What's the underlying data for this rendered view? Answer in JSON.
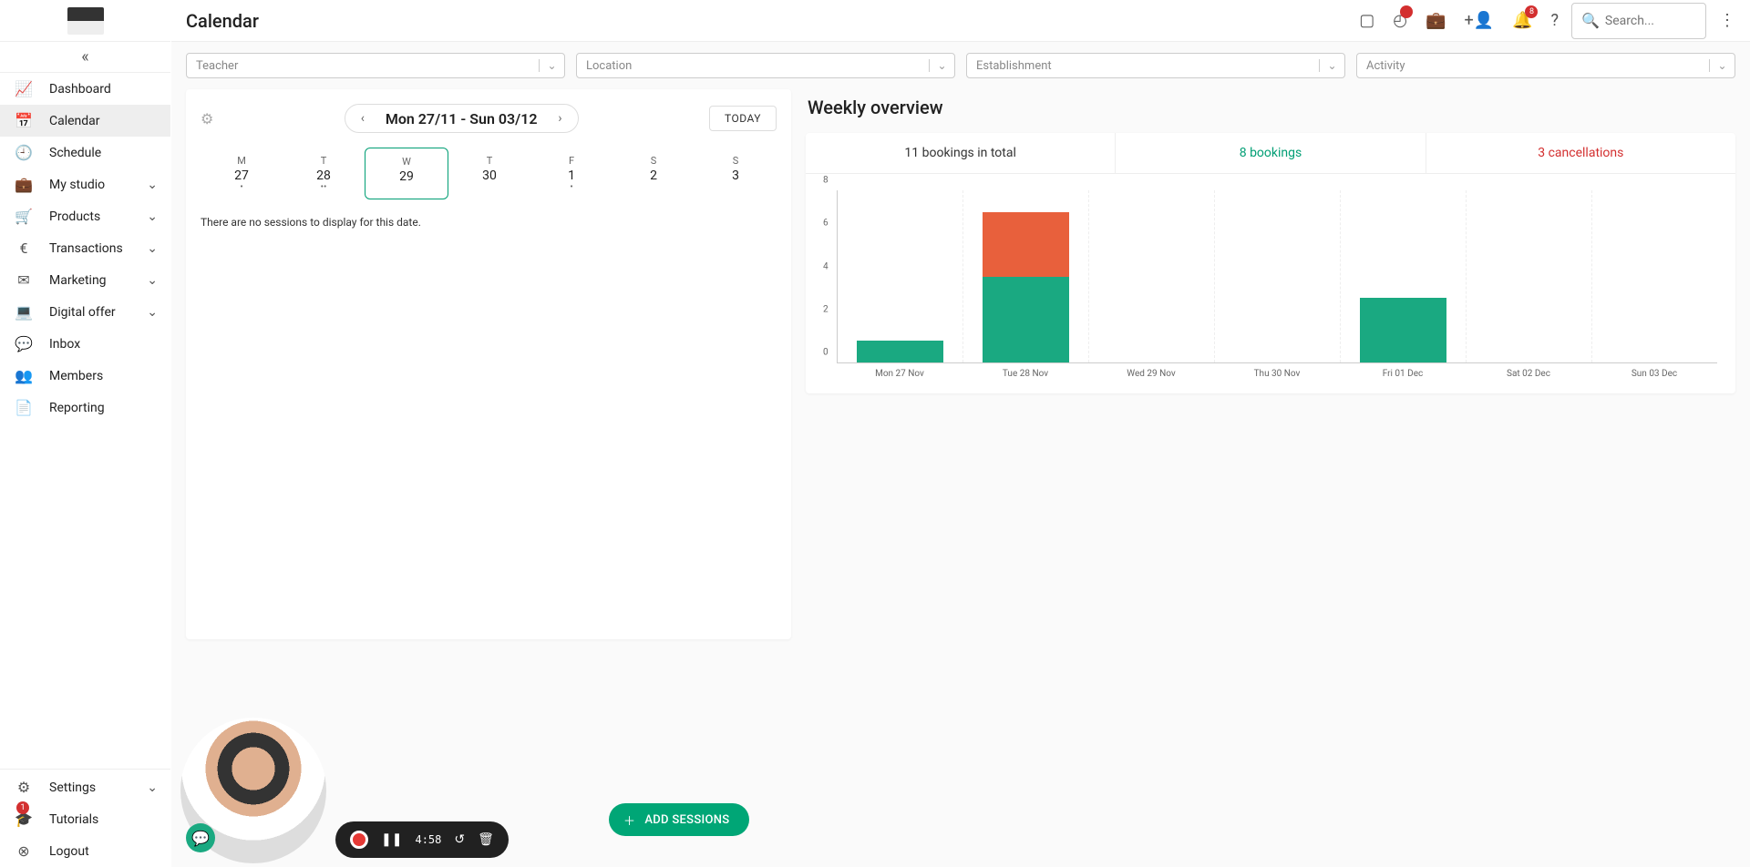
{
  "header": {
    "title": "Calendar",
    "search_placeholder": "Search...",
    "badges": {
      "alert": "",
      "bell": "8"
    }
  },
  "sidebar": {
    "items": [
      {
        "label": "Dashboard",
        "icon": "📈",
        "expandable": false
      },
      {
        "label": "Calendar",
        "icon": "📅",
        "expandable": false,
        "active": true
      },
      {
        "label": "Schedule",
        "icon": "🕘",
        "expandable": false
      },
      {
        "label": "My studio",
        "icon": "💼",
        "expandable": true
      },
      {
        "label": "Products",
        "icon": "🛒",
        "expandable": true
      },
      {
        "label": "Transactions",
        "icon": "€",
        "expandable": true
      },
      {
        "label": "Marketing",
        "icon": "✉",
        "expandable": true
      },
      {
        "label": "Digital offer",
        "icon": "💻",
        "expandable": true
      },
      {
        "label": "Inbox",
        "icon": "💬",
        "expandable": false
      },
      {
        "label": "Members",
        "icon": "👥",
        "expandable": false
      },
      {
        "label": "Reporting",
        "icon": "📄",
        "expandable": false
      }
    ],
    "settings_label": "Settings",
    "tutorials_label": "Tutorials",
    "tutorials_badge": "1",
    "logout_label": "Logout"
  },
  "filters": {
    "teacher": "Teacher",
    "location": "Location",
    "establishment": "Establishment",
    "activity": "Activity"
  },
  "calendar": {
    "date_range": "Mon 27/11 - Sun 03/12",
    "today_label": "TODAY",
    "days": [
      {
        "dow": "M",
        "num": "27",
        "dots": "•"
      },
      {
        "dow": "T",
        "num": "28",
        "dots": "••"
      },
      {
        "dow": "W",
        "num": "29",
        "dots": "",
        "selected": true
      },
      {
        "dow": "T",
        "num": "30",
        "dots": ""
      },
      {
        "dow": "F",
        "num": "1",
        "dots": "•"
      },
      {
        "dow": "S",
        "num": "2",
        "dots": ""
      },
      {
        "dow": "S",
        "num": "3",
        "dots": ""
      }
    ],
    "empty": "There are no sessions to display for this date.",
    "add_sessions": "ADD SESSIONS"
  },
  "overview": {
    "title": "Weekly overview",
    "tabs": {
      "total": "11 bookings in total",
      "bookings": "8 bookings",
      "cancellations": "3 cancellations"
    }
  },
  "recorder": {
    "time": "4:58"
  },
  "chart_data": {
    "type": "bar",
    "categories": [
      "Mon 27 Nov",
      "Tue 28 Nov",
      "Wed 29 Nov",
      "Thu 30 Nov",
      "Fri 01 Dec",
      "Sat 02 Dec",
      "Sun 03 Dec"
    ],
    "series": [
      {
        "name": "bookings",
        "color": "#1aa981",
        "values": [
          1,
          4,
          0,
          0,
          3,
          0,
          0
        ]
      },
      {
        "name": "cancellations",
        "color": "#e8603c",
        "values": [
          0,
          3,
          0,
          0,
          0,
          0,
          0
        ]
      }
    ],
    "ylim": [
      0,
      8
    ],
    "yticks": [
      0,
      2,
      4,
      6,
      8
    ],
    "title": "Weekly overview",
    "xlabel": "",
    "ylabel": ""
  }
}
